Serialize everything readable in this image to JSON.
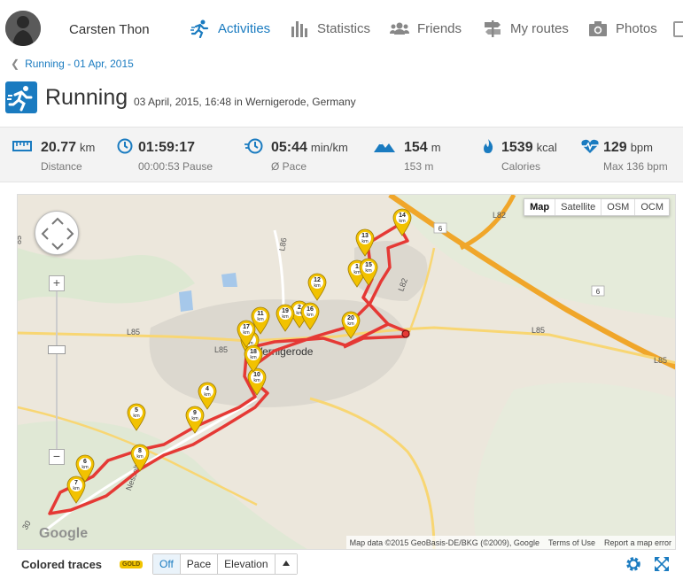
{
  "user": {
    "name": "Carsten Thon",
    "avatar_icon": "runner-avatar-icon"
  },
  "nav": {
    "items": [
      {
        "label": "Activities",
        "icon": "running-icon",
        "active": true
      },
      {
        "label": "Statistics",
        "icon": "bar-chart-icon",
        "active": false
      },
      {
        "label": "Friends",
        "icon": "friends-icon",
        "active": false
      },
      {
        "label": "My routes",
        "icon": "signpost-icon",
        "active": false
      },
      {
        "label": "Photos",
        "icon": "camera-icon",
        "active": false
      }
    ]
  },
  "breadcrumb": {
    "label": "Running - 01 Apr, 2015"
  },
  "activity": {
    "title": "Running",
    "meta": "03 April, 2015, 16:48 in Wernigerode, Germany"
  },
  "stats": {
    "distance": {
      "value": "20.77",
      "unit": "km",
      "sub": "Distance"
    },
    "duration": {
      "value": "01:59:17",
      "sub": "00:00:53 Pause"
    },
    "pace": {
      "value": "05:44",
      "unit": "min/km",
      "sub": "Ø Pace"
    },
    "elevation": {
      "value": "154",
      "unit": "m",
      "sub": "153 m"
    },
    "calories": {
      "value": "1539",
      "unit": "kcal",
      "sub": "Calories"
    },
    "heartrate": {
      "value": "129",
      "unit": "bpm",
      "sub": "Max 136 bpm"
    }
  },
  "map": {
    "types": [
      "Map",
      "Satellite",
      "OSM",
      "OCM"
    ],
    "selected_type": "Map",
    "town_label": "Wernigerode",
    "road_labels": [
      "L85",
      "L85",
      "L85",
      "L86",
      "L82",
      "L82",
      "6",
      "6",
      "6",
      "L85",
      "30"
    ],
    "street_labels": [
      "Nesseltal"
    ],
    "zoom_in": "+",
    "zoom_out": "−",
    "google": "Google",
    "attribution": "Map data ©2015 GeoBasis-DE/BKG (©2009), Google",
    "terms": "Terms of Use",
    "report": "Report a map error",
    "km_markers": [
      "1",
      "2",
      "3",
      "4",
      "5",
      "6",
      "7",
      "8",
      "9",
      "10",
      "11",
      "12",
      "13",
      "14",
      "15",
      "16",
      "17",
      "18",
      "19",
      "20"
    ],
    "km_unit": "km",
    "route_color": "#e53935",
    "marker_color": "#f2c200"
  },
  "bottom": {
    "colored_traces": "Colored traces",
    "gold": "GOLD",
    "options": [
      "Off",
      "Pace",
      "Elevation"
    ],
    "selected": "Off",
    "dropdown_icon": "triangle-up-icon",
    "settings_icon": "gear-icon",
    "fullscreen_icon": "fullscreen-icon"
  },
  "colors": {
    "accent": "#1a7bc0",
    "stat_bg": "#f3f3f3"
  }
}
